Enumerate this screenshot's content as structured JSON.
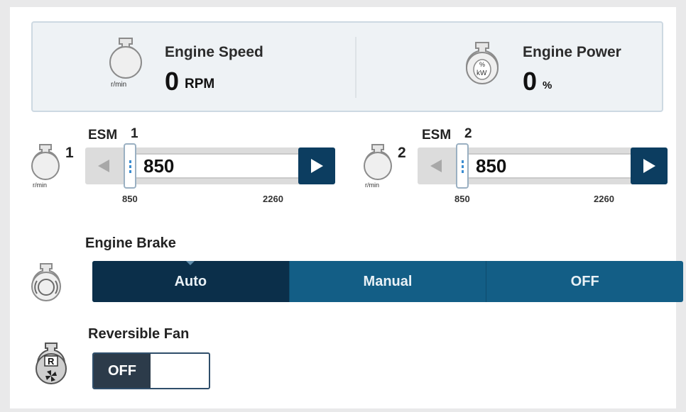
{
  "status": {
    "engine_speed": {
      "label": "Engine Speed",
      "value": "0",
      "unit": "RPM",
      "icon": "engine-speed-icon",
      "icon_unit": "r/min"
    },
    "engine_power": {
      "label": "Engine Power",
      "value": "0",
      "unit": "%",
      "icon": "engine-power-icon",
      "icon_text_top": "%",
      "icon_text_bottom": "kW"
    }
  },
  "esm": [
    {
      "title": "ESM",
      "index": "1",
      "icon_superscript": "1",
      "icon_unit": "r/min",
      "value": "850",
      "min_label": "850",
      "max_label": "2260",
      "min": 850,
      "max": 2260
    },
    {
      "title": "ESM",
      "index": "2",
      "icon_superscript": "2",
      "icon_unit": "r/min",
      "value": "850",
      "min_label": "850",
      "max_label": "2260",
      "min": 850,
      "max": 2260
    }
  ],
  "engine_brake": {
    "label": "Engine Brake",
    "options": [
      "Auto",
      "Manual",
      "OFF"
    ],
    "selected": "Auto"
  },
  "reversible_fan": {
    "label": "Reversible Fan",
    "state_label": "OFF",
    "icon_letter": "R"
  },
  "colors": {
    "accent": "#135e86",
    "accent_dark": "#0b2f4a",
    "button_dark": "#0c3d60"
  }
}
